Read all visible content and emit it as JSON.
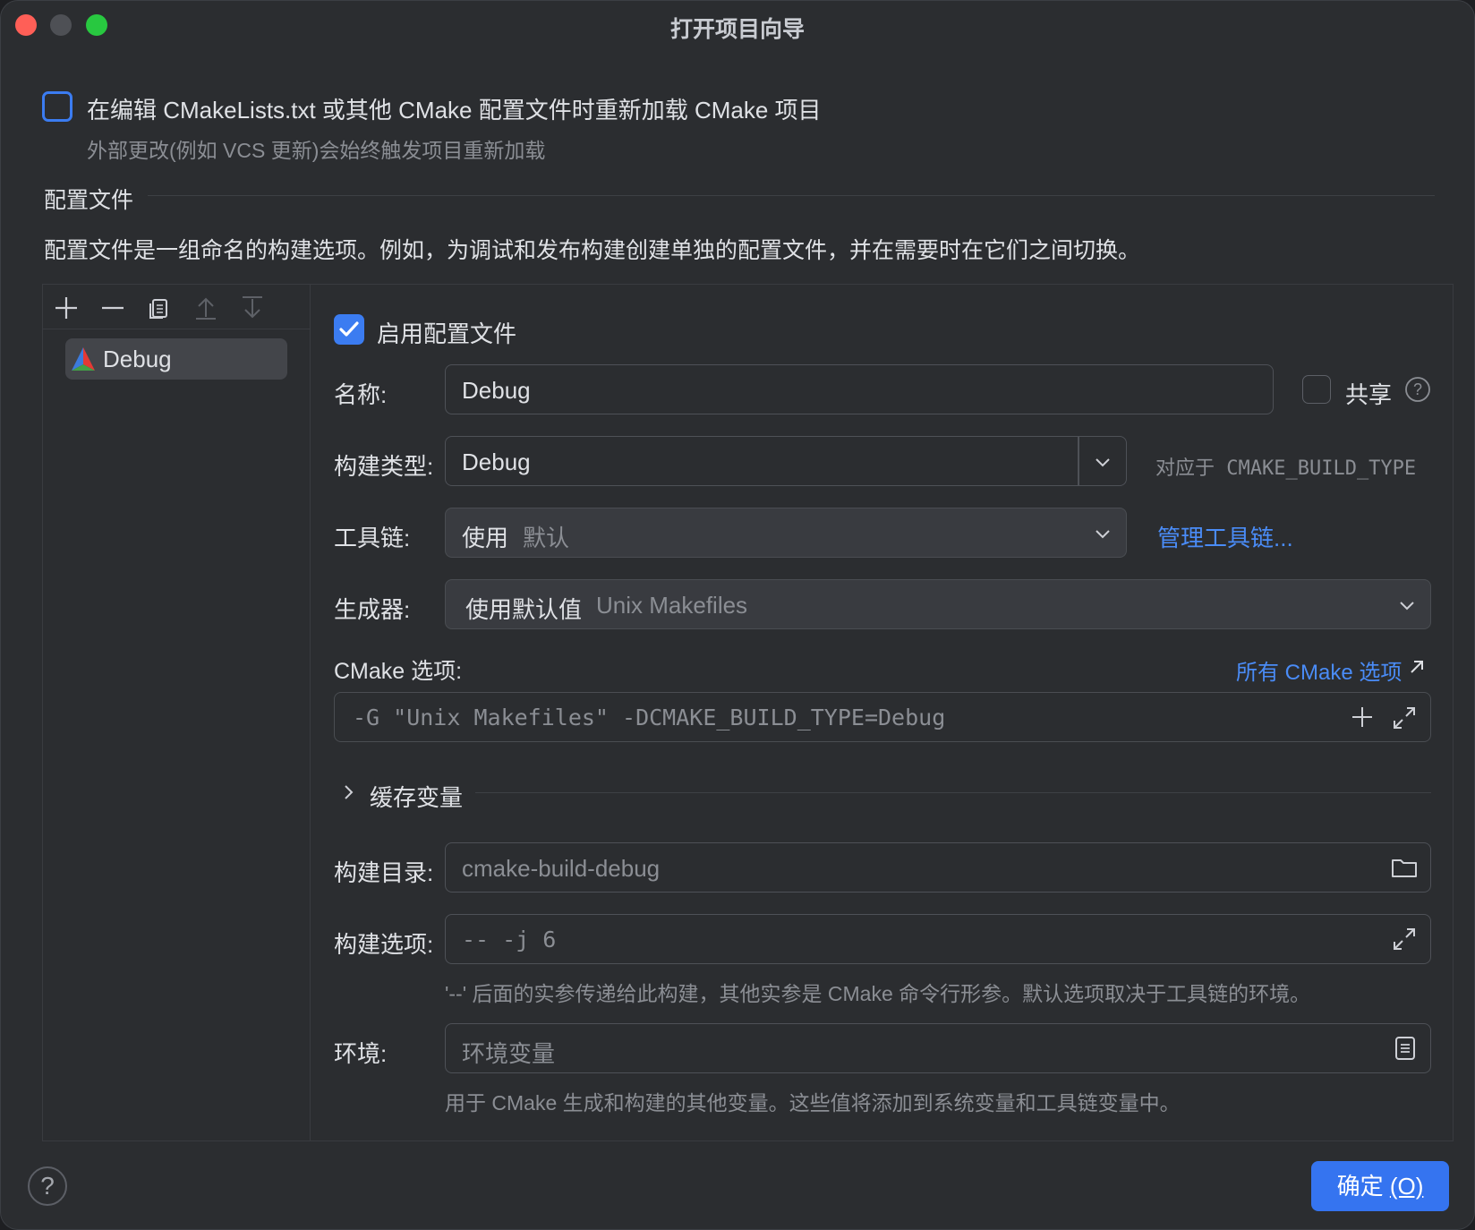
{
  "window": {
    "title": "打开项目向导"
  },
  "reload": {
    "label": "在编辑 CMakeLists.txt 或其他 CMake 配置文件时重新加载 CMake 项目",
    "hint": "外部更改(例如 VCS 更新)会始终触发项目重新加载"
  },
  "profiles": {
    "section_title": "配置文件",
    "description": "配置文件是一组命名的构建选项。例如，为调试和发布构建创建单独的配置文件，并在需要时在它们之间切换。",
    "items": [
      {
        "label": "Debug"
      }
    ]
  },
  "form": {
    "enable_label": "启用配置文件",
    "name_label": "名称:",
    "name_value": "Debug",
    "share_label": "共享",
    "build_type_label": "构建类型:",
    "build_type_value": "Debug",
    "build_type_hint": "对应于 CMAKE_BUILD_TYPE",
    "toolchain_label": "工具链:",
    "toolchain_value": "使用",
    "toolchain_default": "默认",
    "manage_toolchains": "管理工具链...",
    "generator_label": "生成器:",
    "generator_value": "使用默认值",
    "generator_default": "Unix Makefiles",
    "cmake_options_label": "CMake 选项:",
    "all_cmake_options": "所有 CMake 选项",
    "cmake_options_placeholder": "-G \"Unix Makefiles\" -DCMAKE_BUILD_TYPE=Debug",
    "cache_vars_label": "缓存变量",
    "build_dir_label": "构建目录:",
    "build_dir_placeholder": "cmake-build-debug",
    "build_options_label": "构建选项:",
    "build_options_placeholder": "-- -j 6",
    "build_options_hint": "'--' 后面的实参传递给此构建，其他实参是 CMake 命令行形参。默认选项取决于工具链的环境。",
    "env_label": "环境:",
    "env_placeholder": "环境变量",
    "env_hint": "用于 CMake 生成和构建的其他变量。这些值将添加到系统变量和工具链变量中。"
  },
  "footer": {
    "ok_label": "确定",
    "ok_mnemonic": "(O)",
    "help": "?"
  },
  "colors": {
    "accent": "#3574f0",
    "link": "#4a8cf7",
    "background": "#2b2d30"
  }
}
